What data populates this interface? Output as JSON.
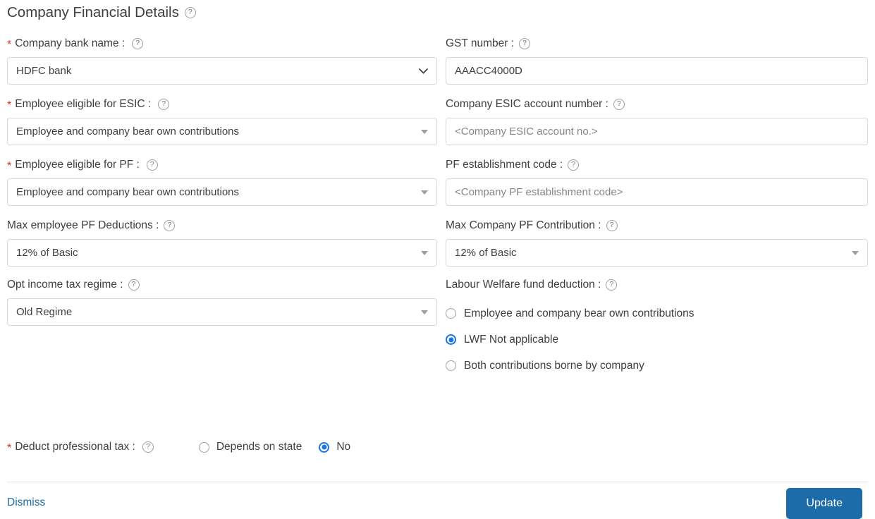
{
  "section": {
    "title": "Company Financial Details",
    "help_icon": "help-circle-icon"
  },
  "fields": {
    "company_bank_name": {
      "label": "Company bank name :",
      "required": true,
      "value": "HDFC bank",
      "control": "native-select"
    },
    "gst_number": {
      "label": "GST number :",
      "required": false,
      "value": "AAACC4000D",
      "control": "text"
    },
    "employee_eligible_esic": {
      "label": "Employee eligible for ESIC :",
      "required": true,
      "value": "Employee and company bear own contributions",
      "control": "dropdown"
    },
    "company_esic_account_number": {
      "label": "Company ESIC account number :",
      "required": false,
      "value": "",
      "placeholder": "<Company ESIC account no.>",
      "control": "text"
    },
    "employee_eligible_pf": {
      "label": "Employee eligible for PF :",
      "required": true,
      "value": "Employee and company bear own contributions",
      "control": "dropdown"
    },
    "pf_establishment_code": {
      "label": "PF establishment code :",
      "required": false,
      "value": "",
      "placeholder": "<Company PF establishment code>",
      "control": "text"
    },
    "max_employee_pf_deductions": {
      "label": "Max employee PF Deductions :",
      "required": false,
      "value": "12% of Basic",
      "control": "dropdown"
    },
    "max_company_pf_contribution": {
      "label": "Max Company PF Contribution :",
      "required": false,
      "value": "12% of Basic",
      "control": "dropdown"
    },
    "opt_income_tax_regime": {
      "label": "Opt income tax regime :",
      "required": false,
      "value": "Old Regime",
      "control": "dropdown"
    },
    "labour_welfare_fund_deduction": {
      "label": "Labour Welfare fund deduction :",
      "required": false,
      "control": "radio-group",
      "options": [
        {
          "label": "Employee and company bear own contributions",
          "selected": false
        },
        {
          "label": "LWF Not applicable",
          "selected": true
        },
        {
          "label": "Both contributions borne by company",
          "selected": false
        }
      ]
    },
    "deduct_professional_tax": {
      "label": "Deduct professional tax :",
      "required": true,
      "control": "radio-group-inline",
      "options": [
        {
          "label": "Depends on state",
          "selected": false
        },
        {
          "label": "No",
          "selected": true
        }
      ]
    }
  },
  "footer": {
    "dismiss_label": "Dismiss",
    "update_label": "Update"
  },
  "colors": {
    "required_star": "#d93025",
    "radio_selected": "#1a73e8",
    "primary_button": "#1b6ca8",
    "link": "#1b6ca8",
    "text": "#3c4043",
    "border": "#d6d9dc"
  }
}
